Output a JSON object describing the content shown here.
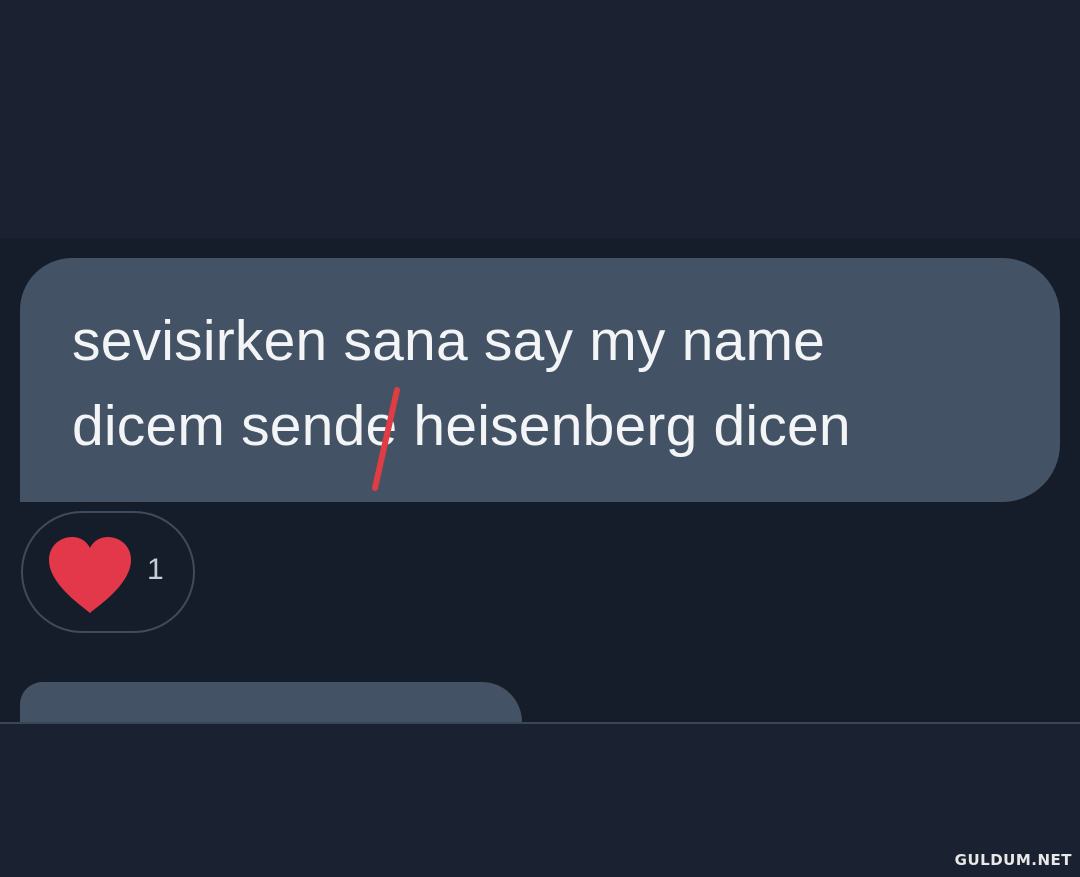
{
  "message": {
    "line1": "sevisirken sana say my name",
    "line2": "dicem sende heisenberg dicen",
    "strike_color": "#e03c44"
  },
  "reaction": {
    "icon": "heart-icon",
    "color": "#e3384a",
    "count": "1"
  },
  "watermark": "GULDUM.NET",
  "colors": {
    "background": "#161d2a",
    "bubble": "#435264",
    "text": "#f2f4f6"
  }
}
